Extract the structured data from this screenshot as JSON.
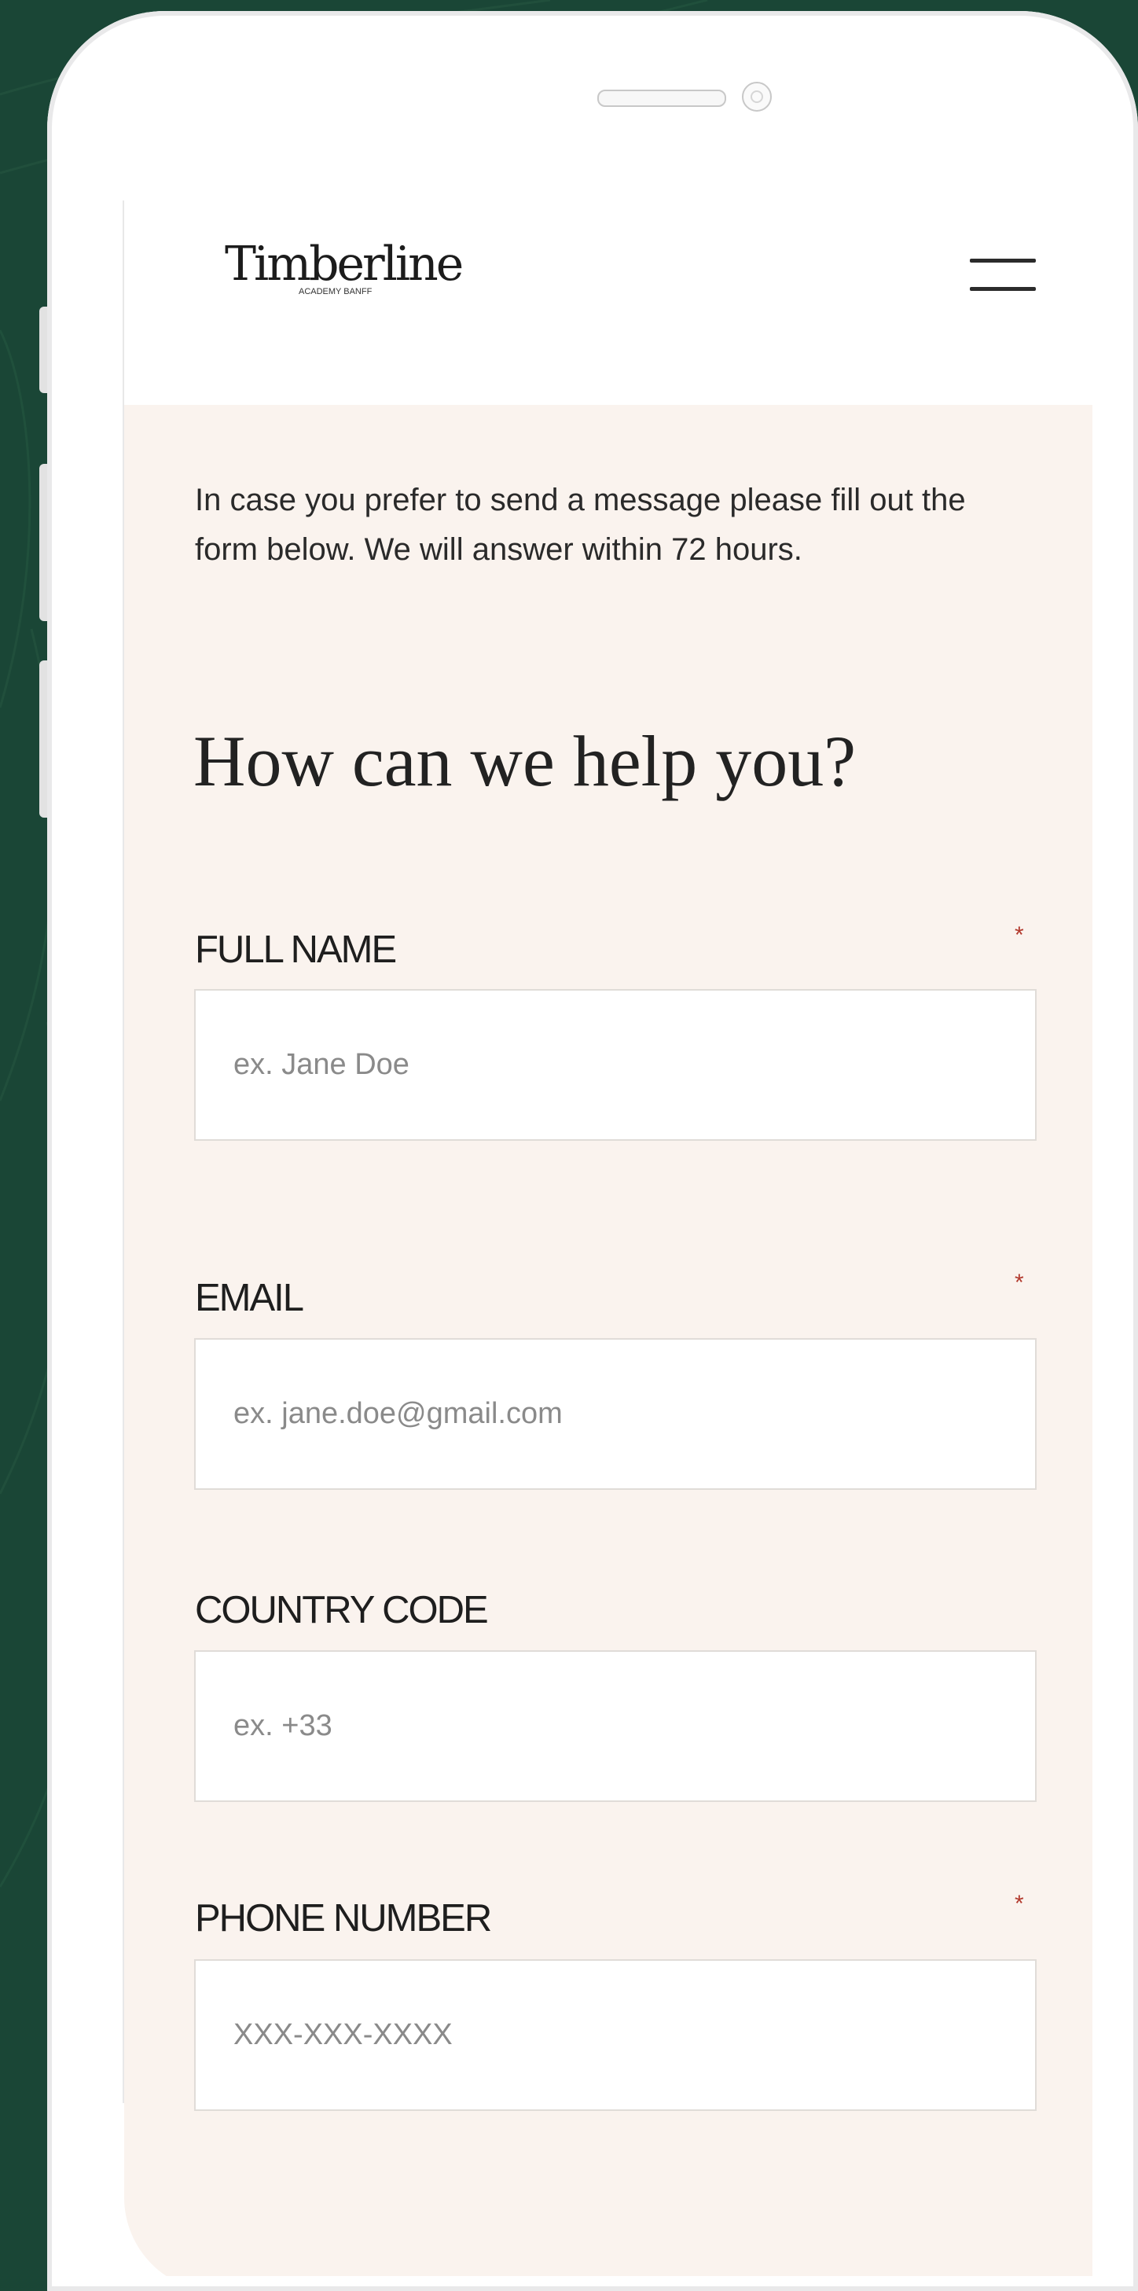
{
  "brand": {
    "name": "Timberline",
    "tagline": "ACADEMY BANFF"
  },
  "icons": {
    "menu": "hamburger-menu-icon",
    "camera": "camera-icon",
    "speaker": "speaker-icon"
  },
  "colors": {
    "background": "#1a4636",
    "content_bg": "#faf3ee",
    "required": "#b23a2e"
  },
  "intro_text": "In case you prefer to send a message please fill out the form below. We will answer within 72 hours.",
  "heading": "How can we help you?",
  "form": {
    "required_mark": "*",
    "full_name": {
      "label": "FULL NAME",
      "placeholder": "ex. Jane Doe",
      "required": true
    },
    "email": {
      "label": "EMAIL",
      "placeholder": "ex. jane.doe@gmail.com",
      "required": true
    },
    "country_code": {
      "label": "COUNTRY CODE",
      "placeholder": "ex. +33",
      "required": false
    },
    "phone_number": {
      "label": "PHONE NUMBER",
      "placeholder": "XXX-XXX-XXXX",
      "required": true
    }
  }
}
